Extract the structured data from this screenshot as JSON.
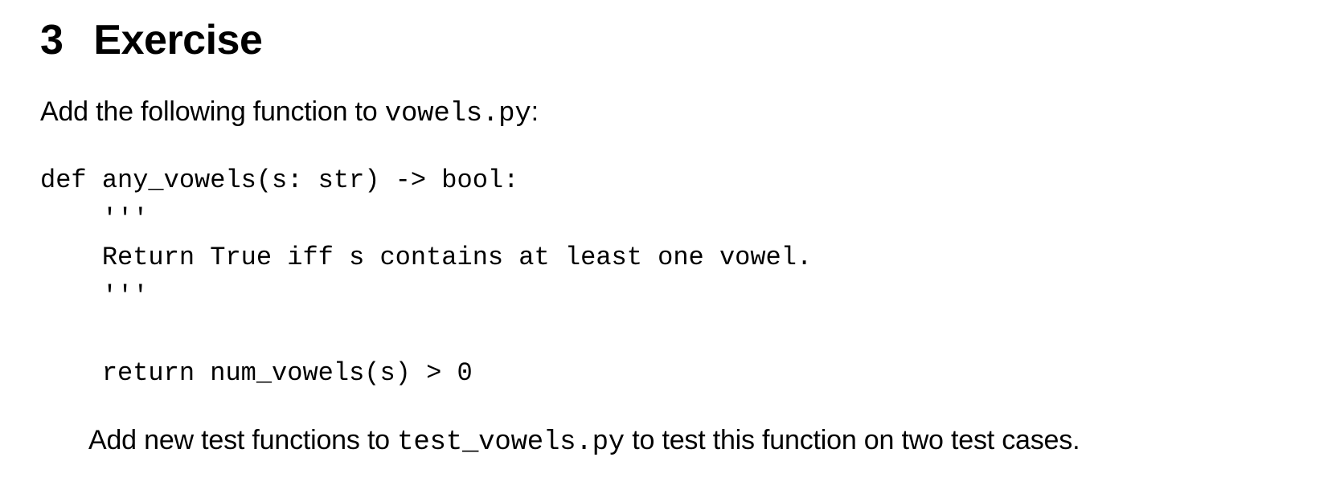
{
  "heading": {
    "number": "3",
    "title": "Exercise"
  },
  "intro": {
    "text_before": "Add the following function to ",
    "filename": "vowels.py",
    "text_after": ":"
  },
  "code": "def any_vowels(s: str) -> bool:\n    '''\n    Return True iff s contains at least one vowel.\n    '''\n\n    return num_vowels(s) > 0",
  "outro": {
    "text_before": "Add new test functions to ",
    "filename": "test_vowels.py",
    "text_after": " to test this function on two test cases."
  }
}
